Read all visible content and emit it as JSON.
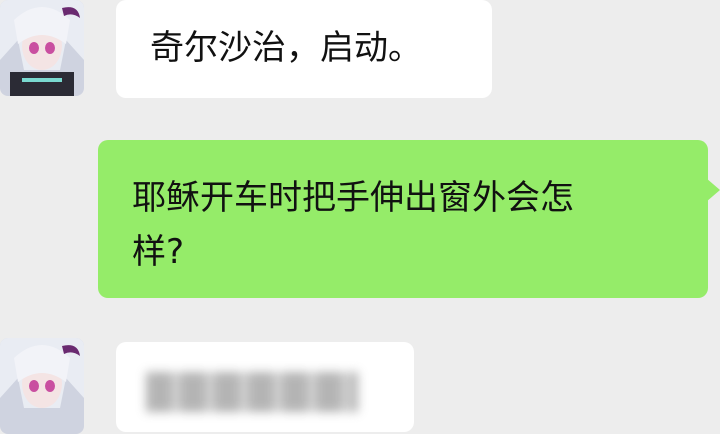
{
  "chat": {
    "messages": [
      {
        "side": "incoming",
        "text": "奇尔沙治，启动。"
      },
      {
        "side": "outgoing",
        "text_line1": "耶稣开车时把手伸出窗外会怎",
        "text_line2": "样?"
      },
      {
        "side": "incoming",
        "text": ""
      }
    ]
  },
  "colors": {
    "background": "#ededed",
    "incoming_bubble": "#ffffff",
    "outgoing_bubble": "#95ec69"
  }
}
